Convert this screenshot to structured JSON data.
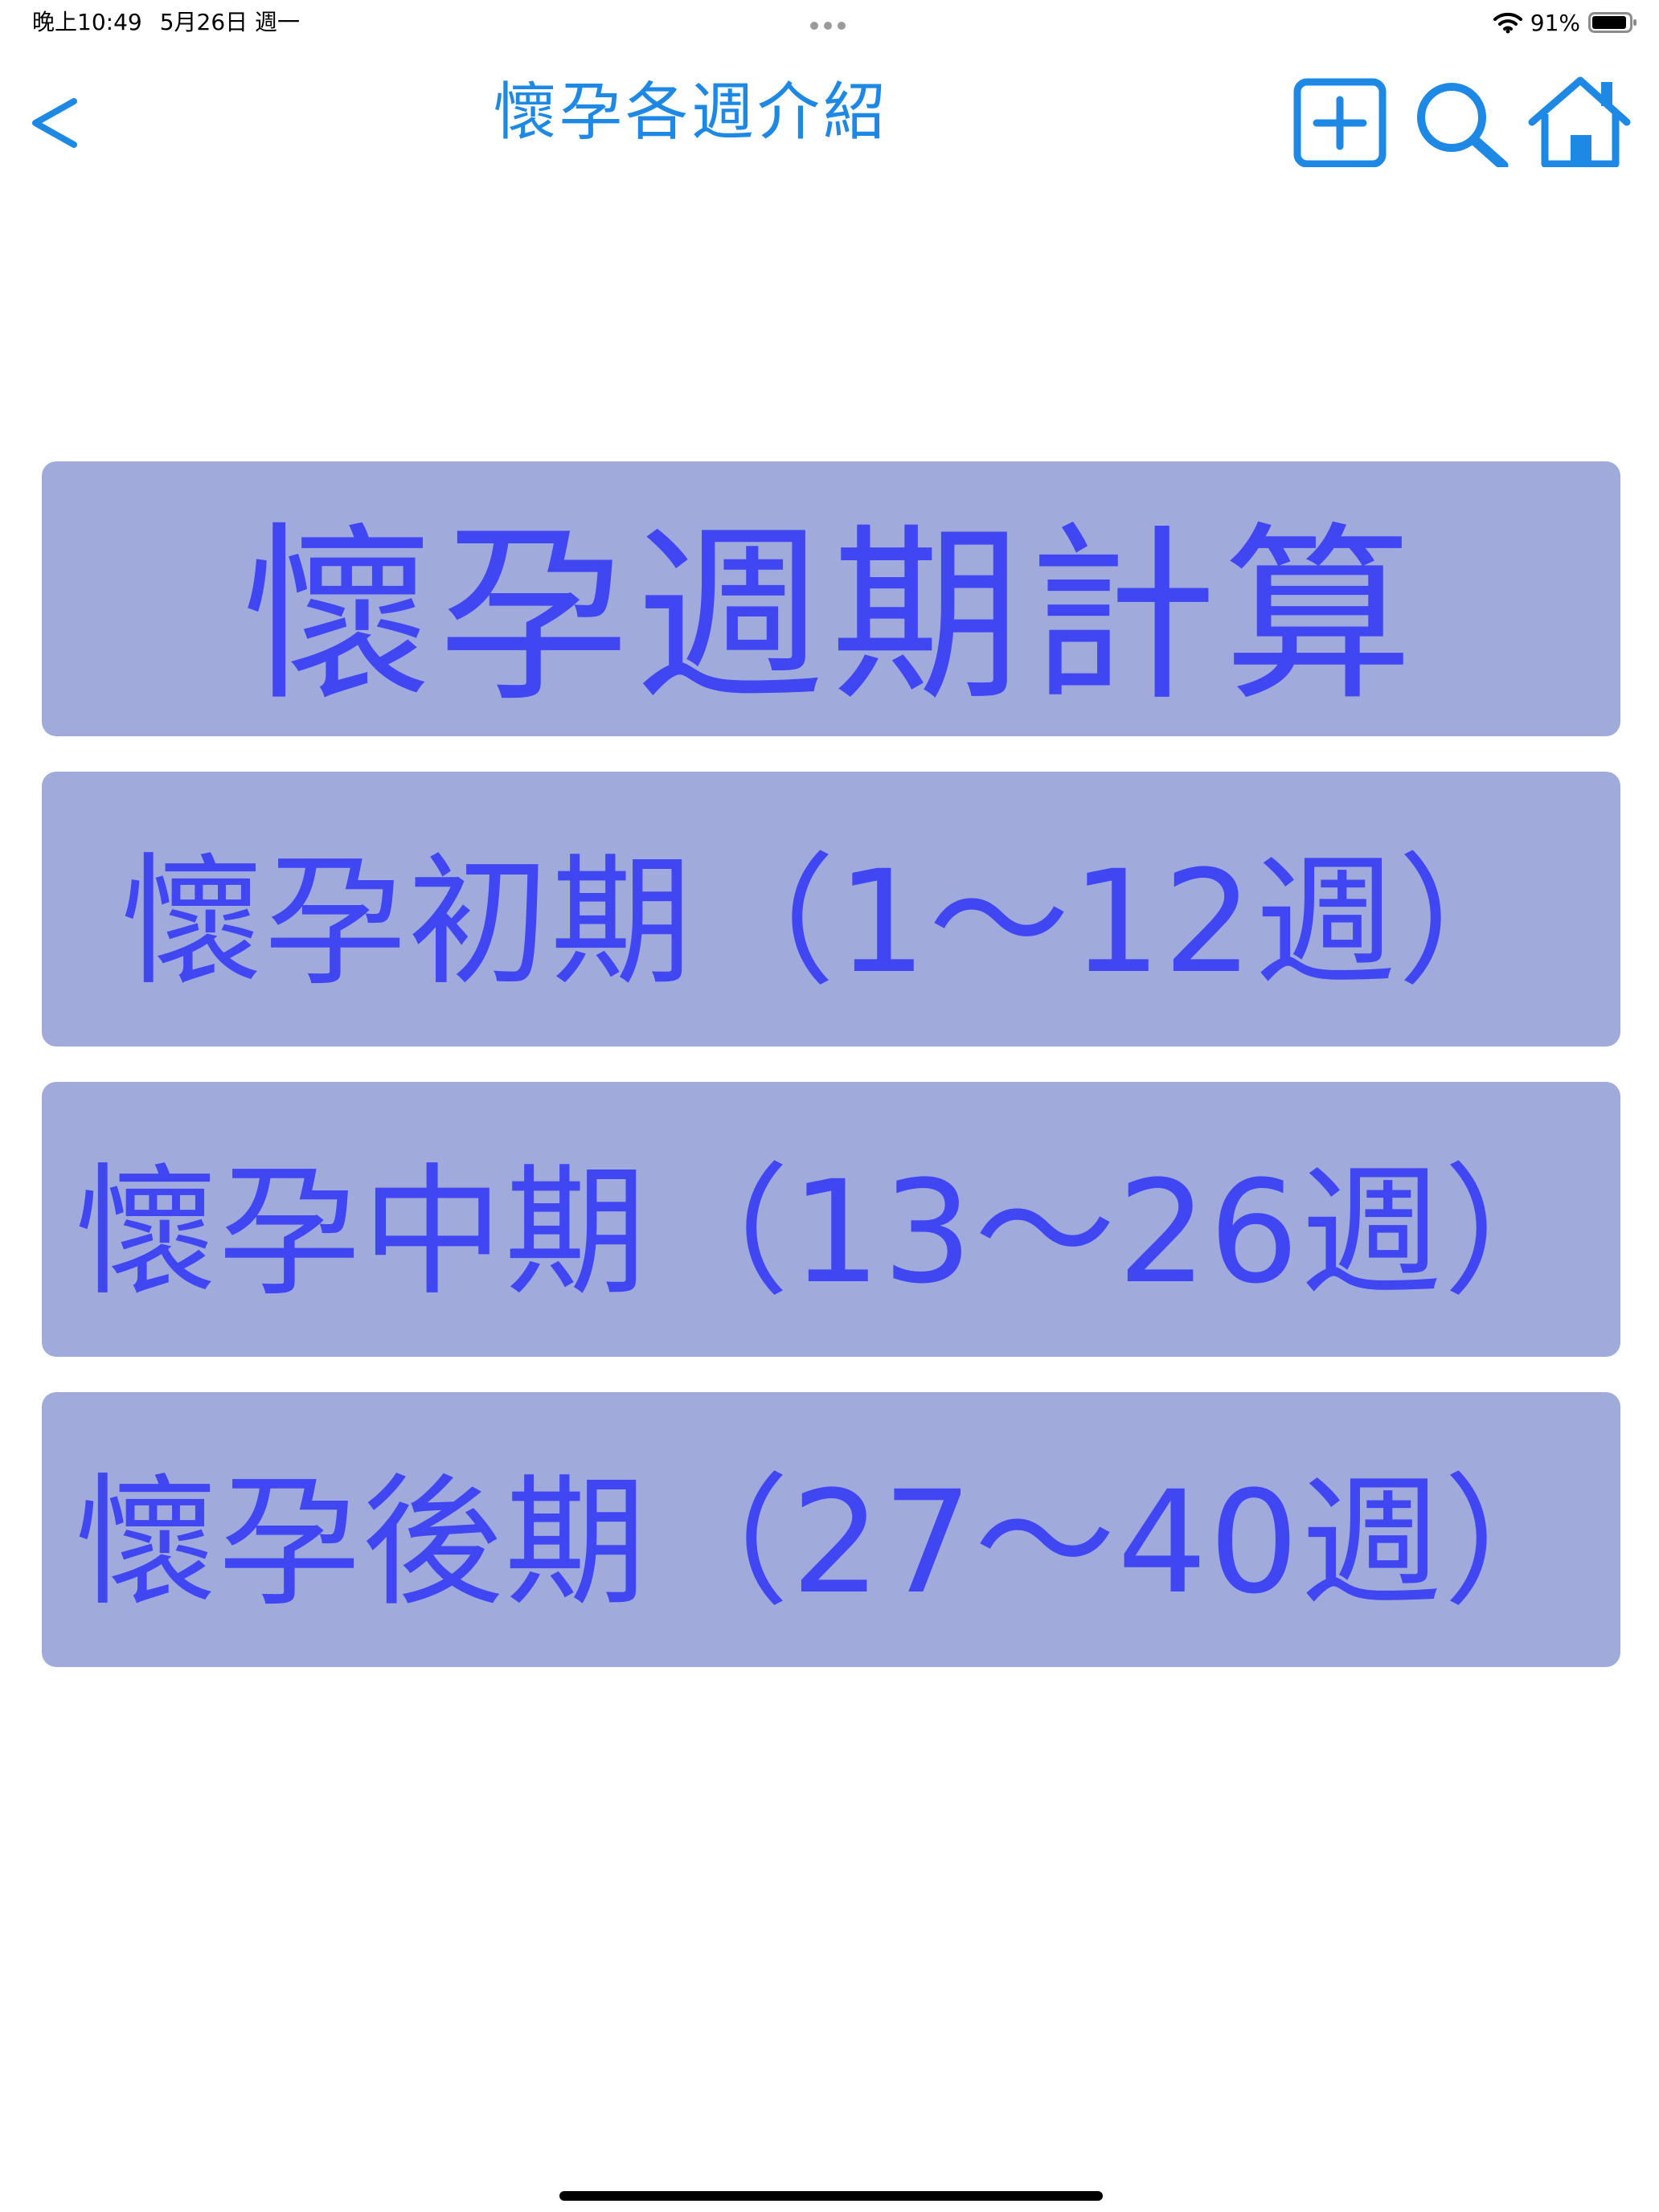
{
  "status_bar": {
    "time": "晚上10:49",
    "date": "5月26日 週一",
    "battery_percent": "91%",
    "battery_level": 0.91
  },
  "nav": {
    "title": "懷孕各週介紹",
    "back_label": "<",
    "icons": {
      "back": "chevron-left-icon",
      "add": "plus-square-icon",
      "search": "search-icon",
      "home": "home-icon"
    }
  },
  "menu": {
    "items": [
      {
        "label": "懷孕週期計算"
      },
      {
        "label": "懷孕初期（1～12週）"
      },
      {
        "label": "懷孕中期（13～26週）"
      },
      {
        "label": "懷孕後期（27～40週）"
      }
    ]
  },
  "colors": {
    "accent": "#1e88e5",
    "button_bg": "#a0abdb",
    "button_text": "#4046f2"
  }
}
